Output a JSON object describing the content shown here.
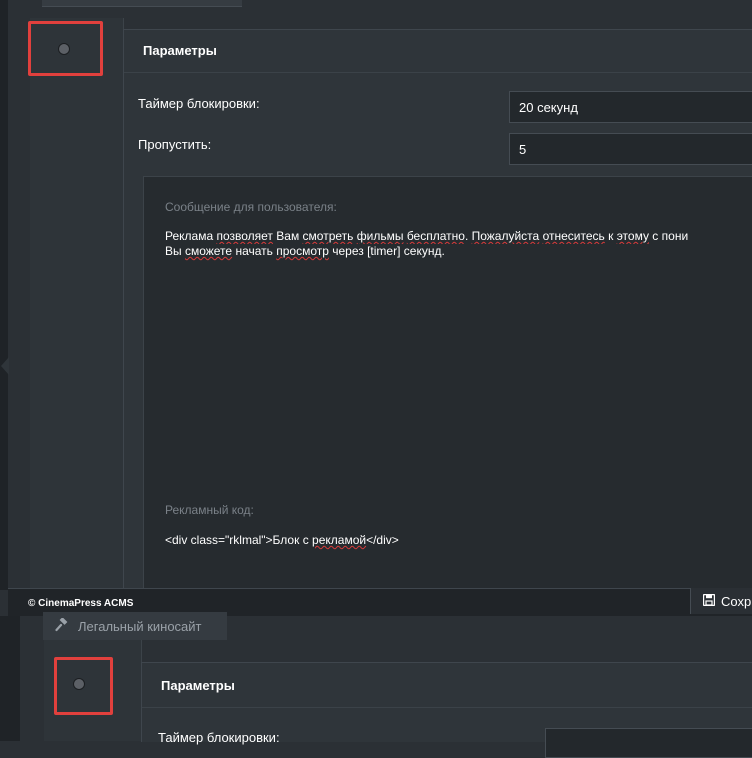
{
  "upper": {
    "params_title": "Параметры",
    "lock_timer_label": "Таймер блокировки:",
    "lock_timer_value": "20 секунд",
    "skip_label": "Пропустить:",
    "skip_value": "5",
    "message_label": "Сообщение для пользователя:",
    "message_line1_parts": [
      "Реклама ",
      "позволяет",
      " Вам ",
      "смотреть",
      " ",
      "фильмы",
      " ",
      "бесплатно",
      ". ",
      "Пожалуйста",
      " ",
      "отнеситесь",
      " к ",
      "этому",
      " с ",
      "пони"
    ],
    "message_line2_parts": [
      "Вы ",
      "сможете",
      " начать ",
      "просмотр",
      " через [timer] секунд."
    ],
    "ad_code_label": "Рекламный код:",
    "ad_code_prefix": "<div class=\"rklmal\">Блок с ",
    "ad_code_squiggle": "рекламой",
    "ad_code_suffix": "</div>"
  },
  "footer": {
    "copyright": "© CinemaPress ACMS",
    "save_label": "Сохр",
    "save_icon": "floppy-disk-icon"
  },
  "lower": {
    "tab_label": "Легальный киносайт",
    "tab_icon": "gavel-icon",
    "params_title": "Параметры",
    "lock_timer_label": "Таймер блокировки:"
  },
  "colors": {
    "highlight": "#e1403d",
    "background": "#2b3035",
    "field": "#23282c"
  }
}
